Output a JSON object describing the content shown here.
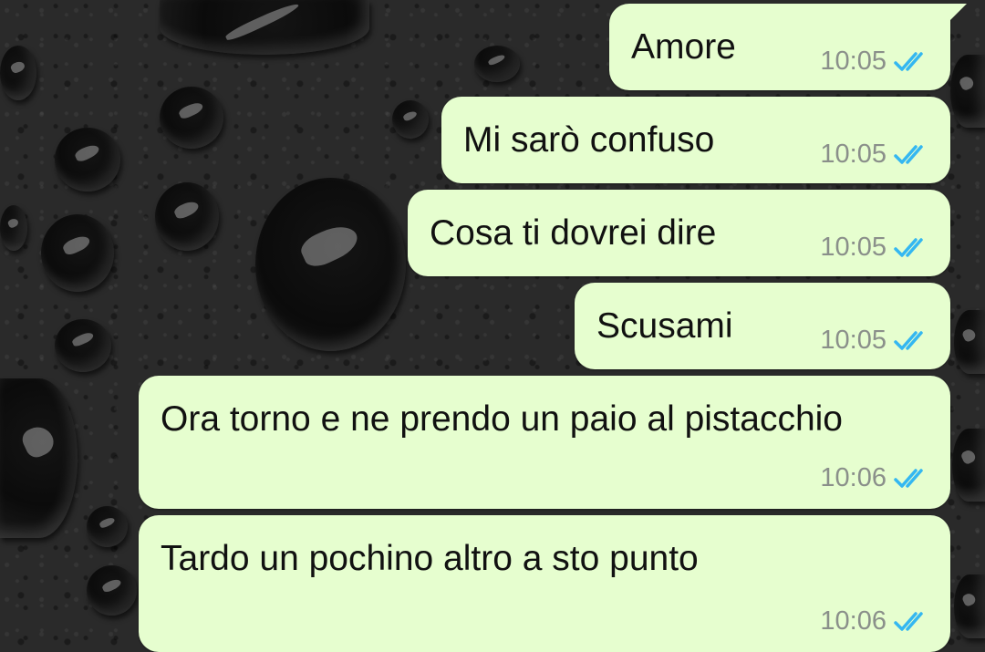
{
  "chat": {
    "messages": [
      {
        "text": "Amore",
        "time": "10:05",
        "status": "read"
      },
      {
        "text": "Mi sarò confuso",
        "time": "10:05",
        "status": "read"
      },
      {
        "text": "Cosa ti dovrei dire",
        "time": "10:05",
        "status": "read"
      },
      {
        "text": "Scusami",
        "time": "10:05",
        "status": "read"
      },
      {
        "text": "Ora torno e ne prendo un paio al pistacchio",
        "time": "10:06",
        "status": "read"
      },
      {
        "text": "Tardo un pochino altro a sto punto",
        "time": "10:06",
        "status": "read"
      }
    ],
    "status_icon": "double-check-read-icon",
    "colors": {
      "bubble": "#e6fecf",
      "check": "#34b7f1",
      "time": "#8a8f8a",
      "wallpaper": "#2a2a2a"
    }
  }
}
